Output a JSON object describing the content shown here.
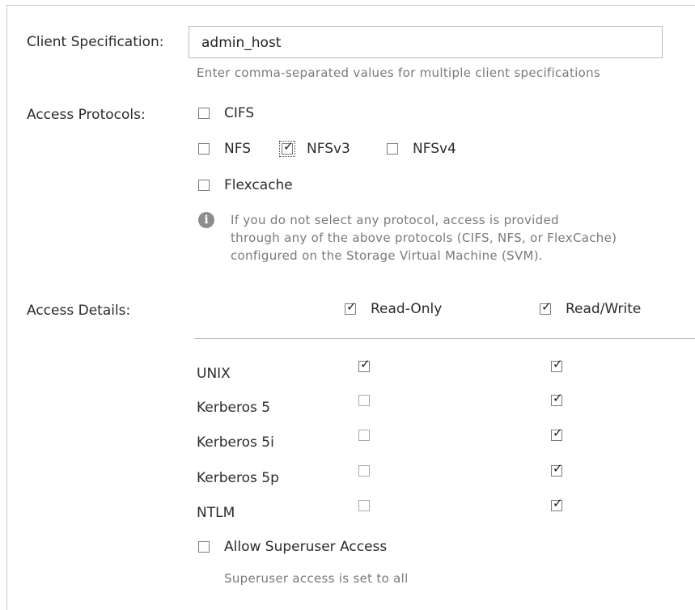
{
  "client_spec": {
    "label": "Client Specification:",
    "value": "admin_host",
    "hint": "Enter comma-separated values for multiple client specifications"
  },
  "access_protocols": {
    "label": "Access Protocols:",
    "options": [
      {
        "label": "CIFS",
        "checked": false
      },
      {
        "label": "NFS",
        "checked": false
      },
      {
        "label": "NFSv3",
        "checked": true
      },
      {
        "label": "NFSv4",
        "checked": false
      },
      {
        "label": "Flexcache",
        "checked": false
      }
    ],
    "info_lines": [
      "If you do not select any protocol, access is provided",
      "through any of the above protocols (CIFS, NFS, or FlexCache)",
      "configured on the Storage Virtual Machine (SVM)."
    ]
  },
  "access_details": {
    "label": "Access Details:",
    "columns": [
      {
        "label": "Read-Only",
        "checked": true
      },
      {
        "label": "Read/Write",
        "checked": true
      }
    ],
    "rows": [
      {
        "label": "UNIX",
        "read_only": true,
        "read_write": true
      },
      {
        "label": "Kerberos 5",
        "read_only": false,
        "read_write": true
      },
      {
        "label": "Kerberos 5i",
        "read_only": false,
        "read_write": true
      },
      {
        "label": "Kerberos 5p",
        "read_only": false,
        "read_write": true
      },
      {
        "label": "NTLM",
        "read_only": false,
        "read_write": true
      }
    ]
  },
  "superuser": {
    "label": "Allow Superuser Access",
    "checked": false,
    "hint": "Superuser access is set to all"
  }
}
